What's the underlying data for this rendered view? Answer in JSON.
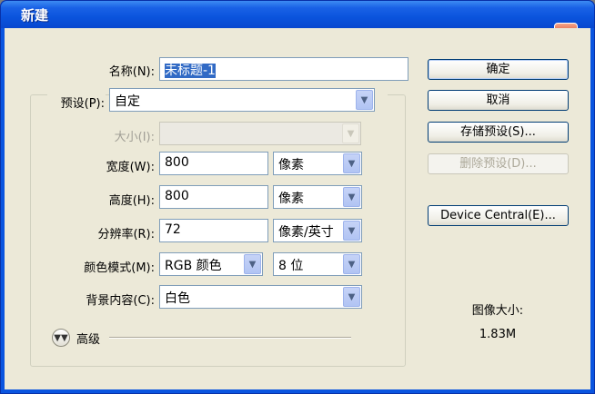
{
  "window": {
    "title": "新建"
  },
  "form": {
    "name_label": "名称(N):",
    "name_value": "未标题-1",
    "preset_label": "预设(P):",
    "preset_value": "自定",
    "size_label": "大小(I):",
    "size_value": "",
    "width_label": "宽度(W):",
    "width_value": "800",
    "width_unit": "像素",
    "height_label": "高度(H):",
    "height_value": "800",
    "height_unit": "像素",
    "resolution_label": "分辨率(R):",
    "resolution_value": "72",
    "resolution_unit": "像素/英寸",
    "color_mode_label": "颜色模式(M):",
    "color_mode_value": "RGB 颜色",
    "bit_depth_value": "8 位",
    "background_label": "背景内容(C):",
    "background_value": "白色",
    "advanced_label": "高级"
  },
  "buttons": {
    "ok": "确定",
    "cancel": "取消",
    "save_preset": "存储预设(S)...",
    "delete_preset": "删除预设(D)...",
    "device_central": "Device Central(E)..."
  },
  "info": {
    "image_size_label": "图像大小:",
    "image_size_value": "1.83M"
  },
  "icons": {
    "close": "close-icon",
    "dropdown": "chevron-down-icon",
    "advanced_toggle": "double-chevron-down-icon"
  },
  "colors": {
    "titlebar": "#0a55e0",
    "dialog_bg": "#ece9d8",
    "selection": "#316ac5"
  }
}
